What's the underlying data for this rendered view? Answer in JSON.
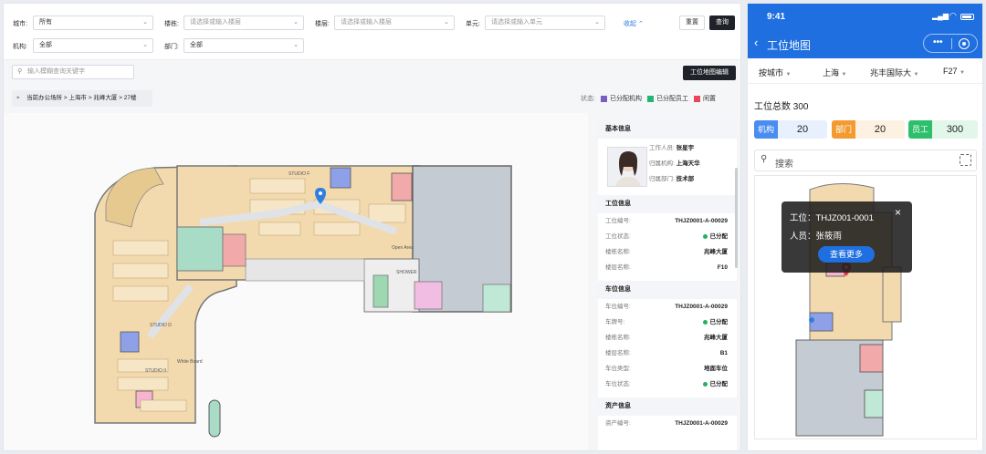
{
  "filters": {
    "city": {
      "label": "城市:",
      "value": "所有"
    },
    "building": {
      "label": "楼栋:",
      "placeholder": "请选择或输入楼层"
    },
    "floor": {
      "label": "楼层:",
      "placeholder": "请选择或输入楼层"
    },
    "unit": {
      "label": "单元:",
      "placeholder": "请选择或输入单元"
    },
    "org": {
      "label": "机构:",
      "value": "全部"
    },
    "dept": {
      "label": "部门:",
      "value": "全部"
    },
    "collapse": "收起",
    "reset": "重置",
    "query": "查询"
  },
  "search_placeholder": "输入模糊查询关键字",
  "edit_button": "工位地图编辑",
  "location": "当前办公场所 > 上海市 > 兆峰大厦 > 27楼",
  "legend": {
    "title": "状态:",
    "items": [
      {
        "label": "已分配机构",
        "color": "#7b5cc7"
      },
      {
        "label": "已分配员工",
        "color": "#22b573"
      },
      {
        "label": "闲置",
        "color": "#e8455e"
      }
    ]
  },
  "map_labels": [
    "STUDIO F",
    "STUDIO D",
    "STUDIO II",
    "White Board",
    "Open Area",
    "SHOWER"
  ],
  "info": {
    "basic": {
      "title": "基本信息",
      "staff_label": "工作人员:",
      "staff": "张星宇",
      "org_label": "归属机构:",
      "org": "上海天华",
      "dept_label": "归属部门:",
      "dept": "技术部"
    },
    "seat": {
      "title": "工位信息",
      "rows": [
        {
          "k": "工位编号:",
          "v": "THJZ0001-A-00029"
        },
        {
          "k": "工位状态:",
          "v": "已分配",
          "dot": true
        },
        {
          "k": "楼栋名称:",
          "v": "兆峰大厦"
        },
        {
          "k": "楼层名称:",
          "v": "F10"
        }
      ]
    },
    "parking": {
      "title": "车位信息",
      "rows": [
        {
          "k": "车位编号:",
          "v": "THJZ0001-A-00029"
        },
        {
          "k": "车牌号:",
          "v": "已分配",
          "dot": true
        },
        {
          "k": "楼栋名称:",
          "v": "兆峰大厦"
        },
        {
          "k": "楼层名称:",
          "v": "B1"
        },
        {
          "k": "车位类型:",
          "v": "地面车位"
        },
        {
          "k": "车位状态:",
          "v": "已分配",
          "dot": true
        }
      ]
    },
    "asset": {
      "title": "资产信息",
      "rows": [
        {
          "k": "资产编号:",
          "v": "THJZ0001-A-00029"
        }
      ]
    }
  },
  "phone": {
    "time": "9:41",
    "title": "工位地图",
    "filters": [
      "按城市",
      "上海",
      "兆丰国际大",
      "F27"
    ],
    "total": "工位总数 300",
    "stats": [
      {
        "k": "机构",
        "n": "20",
        "c": "#4a8df0",
        "bg": "#e8f0fd"
      },
      {
        "k": "部门",
        "n": "20",
        "c": "#f39b30",
        "bg": "#fdf1e1"
      },
      {
        "k": "员工",
        "n": "300",
        "c": "#2dbf6b",
        "bg": "#e2f6ea"
      }
    ],
    "search": "搜索",
    "popup": {
      "seat": "工位：THJZ001-0001",
      "person": "人员：张筱雨",
      "more": "查看更多"
    }
  }
}
